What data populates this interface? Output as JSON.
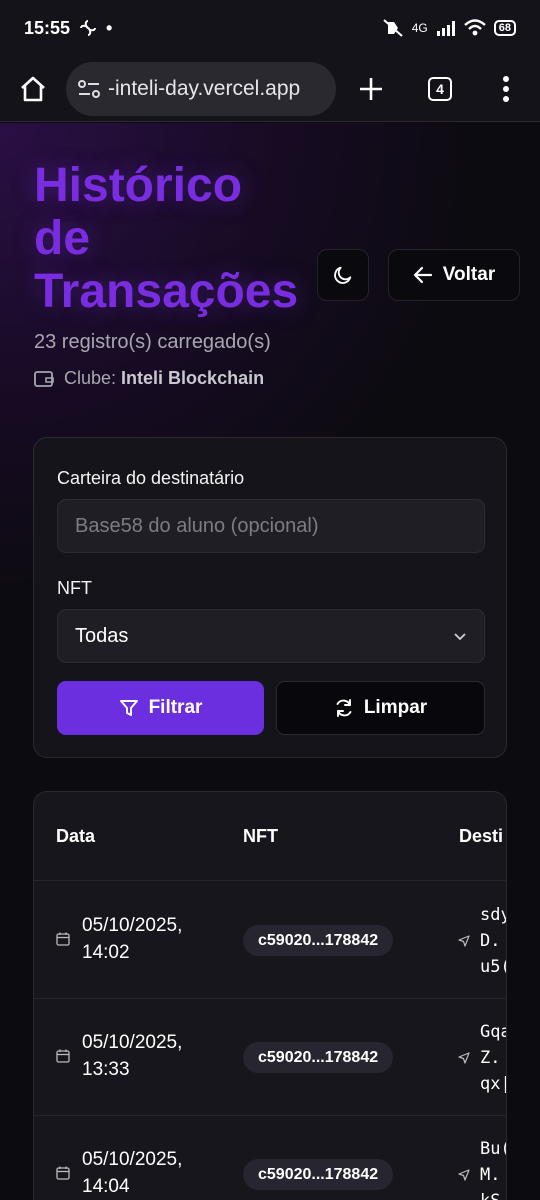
{
  "status": {
    "time": "15:55",
    "dot": "•",
    "network": "4G",
    "battery": "68"
  },
  "browser": {
    "url": "-inteli-day.vercel.app",
    "tab_count": "4"
  },
  "header": {
    "title_lines": [
      "Histórico",
      "de",
      "Transações"
    ],
    "back_label": "Voltar",
    "records": "23 registro(s) carregado(s)",
    "club_label": "Clube:",
    "club_name": "Inteli Blockchain"
  },
  "filters": {
    "wallet_label": "Carteira do destinatário",
    "wallet_placeholder": "Base58 do aluno (opcional)",
    "nft_label": "NFT",
    "nft_selected": "Todas",
    "filter_button": "Filtrar",
    "clear_button": "Limpar"
  },
  "table": {
    "columns": [
      "Data",
      "NFT",
      "Desti"
    ],
    "rows": [
      {
        "date": "05/10/2025,",
        "time": "14:02",
        "nft": "c59020...178842",
        "dest": "sdy\nD.\nu5("
      },
      {
        "date": "05/10/2025,",
        "time": "13:33",
        "nft": "c59020...178842",
        "dest": "Gqa\nZ.\nqx|"
      },
      {
        "date": "05/10/2025,",
        "time": "14:04",
        "nft": "c59020...178842",
        "dest": "Bu(\nM.\nkS"
      }
    ]
  },
  "colors": {
    "accent": "#7a2de0",
    "button_primary": "#6b2fe0",
    "background": "#0c0b10"
  }
}
